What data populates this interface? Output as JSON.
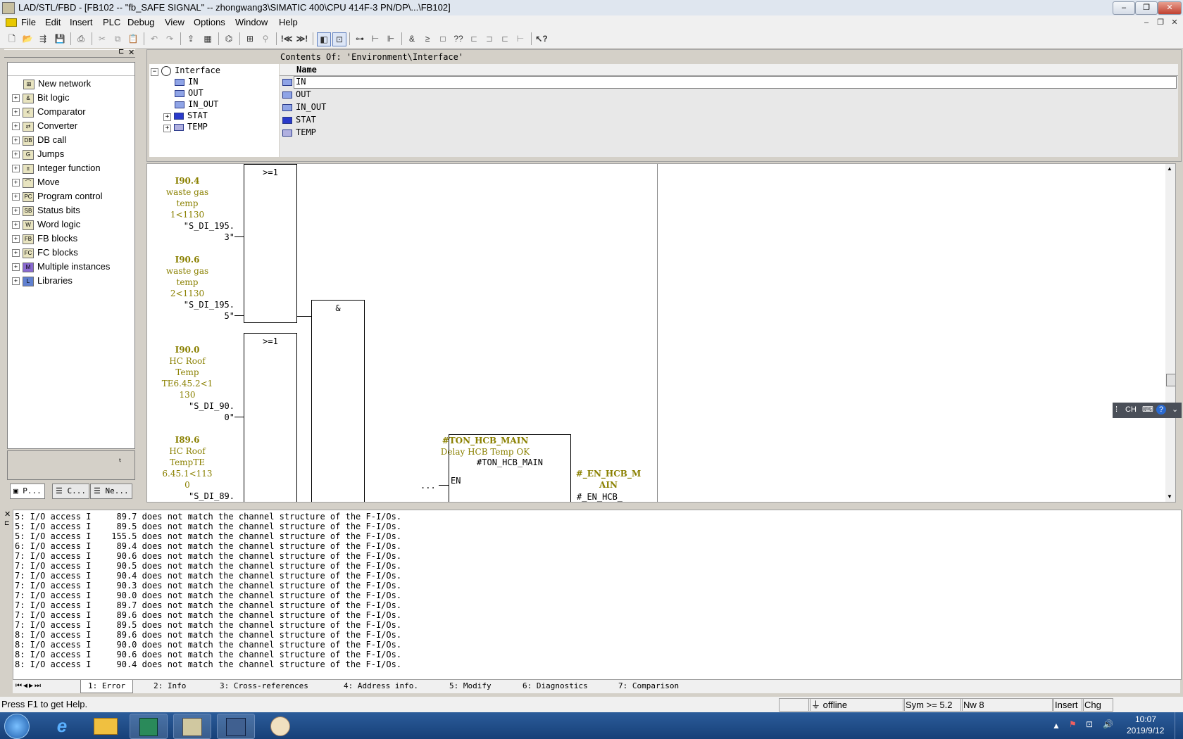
{
  "window": {
    "title": "LAD/STL/FBD  - [FB102 -- \"fb_SAFE SIGNAL\" -- zhongwang3\\SIMATIC 400\\CPU 414F-3 PN/DP\\...\\FB102]",
    "controls": [
      "–",
      "❐",
      "✕"
    ]
  },
  "menu": [
    "File",
    "Edit",
    "Insert",
    "PLC",
    "Debug",
    "View",
    "Options",
    "Window",
    "Help"
  ],
  "mdi_controls": [
    "–",
    "❐",
    "✕"
  ],
  "toolbar_icons": [
    "new-icon",
    "open-icon",
    "accessible-nodes-icon",
    "save-icon",
    "print-icon",
    "cut-icon",
    "copy-icon",
    "paste-icon",
    "undo-icon",
    "redo-icon",
    "load-icon",
    "compare-icon",
    "monitor-icon",
    "ref-icon",
    "search-icon",
    "goto-icon",
    "prev-network-icon",
    "next-network-icon",
    "overview-icon",
    "details-icon",
    "network-insert-icon",
    "branch-icon",
    "box-icon",
    "contact-icon",
    "coil-icon",
    "ladder1-icon",
    "ladder2-icon",
    "ladder3-icon",
    "ladder4-icon",
    "help-icon"
  ],
  "catalog": {
    "items": [
      {
        "label": "New network",
        "icon": "new-network-icon",
        "expandable": false
      },
      {
        "label": "Bit logic",
        "icon": "bit-logic-icon",
        "expandable": true
      },
      {
        "label": "Comparator",
        "icon": "comparator-icon",
        "expandable": true
      },
      {
        "label": "Converter",
        "icon": "converter-icon",
        "expandable": true
      },
      {
        "label": "DB call",
        "icon": "db-call-icon",
        "expandable": true
      },
      {
        "label": "Jumps",
        "icon": "jumps-icon",
        "expandable": true
      },
      {
        "label": "Integer function",
        "icon": "integer-function-icon",
        "expandable": true
      },
      {
        "label": "Move",
        "icon": "move-icon",
        "expandable": true
      },
      {
        "label": "Program control",
        "icon": "program-control-icon",
        "expandable": true
      },
      {
        "label": "Status bits",
        "icon": "status-bits-icon",
        "expandable": true
      },
      {
        "label": "Word logic",
        "icon": "word-logic-icon",
        "expandable": true
      },
      {
        "label": "FB blocks",
        "icon": "fb-blocks-icon",
        "expandable": true
      },
      {
        "label": "FC blocks",
        "icon": "fc-blocks-icon",
        "expandable": true
      },
      {
        "label": "Multiple instances",
        "icon": "multiple-instances-icon",
        "expandable": true
      },
      {
        "label": "Libraries",
        "icon": "libraries-icon",
        "expandable": true
      }
    ],
    "tabs": [
      "P...",
      "C...",
      "Ne..."
    ]
  },
  "interface_tree": {
    "root": "Interface",
    "items": [
      "IN",
      "OUT",
      "IN_OUT",
      "STAT",
      "TEMP"
    ]
  },
  "interface_contents": {
    "heading": "Contents Of: 'Environment\\Interface'",
    "column": "Name",
    "rows": [
      "IN",
      "OUT",
      "IN_OUT",
      "STAT",
      "TEMP"
    ]
  },
  "fbd": {
    "or1": ">=1",
    "or2": ">=1",
    "and": "&",
    "inputs": [
      {
        "addr": "I90.4",
        "comment": [
          "waste gas",
          "temp",
          "1<1130"
        ],
        "symbol": [
          "\"S_DI_195.",
          "3\""
        ]
      },
      {
        "addr": "I90.6",
        "comment": [
          "waste gas",
          "temp",
          "2<1130"
        ],
        "symbol": [
          "\"S_DI_195.",
          "5\""
        ]
      },
      {
        "addr": "I90.0",
        "comment": [
          "HC Roof",
          "Temp",
          "TE6.45.2<1",
          "130"
        ],
        "symbol": [
          "\"S_DI_90.",
          "0\""
        ]
      },
      {
        "addr": "I89.6",
        "comment": [
          "HC Roof",
          "TempTE",
          "6.45.1<113",
          "0"
        ],
        "symbol": [
          "\"S_DI_89."
        ]
      }
    ],
    "timer": {
      "name": "#TON_HCB_MAIN",
      "comment": "Delay HCB Temp OK",
      "instance": "#TON_HCB_MAIN",
      "en": "EN",
      "dots": "..."
    },
    "output": {
      "name": [
        "#_EN_HCB_M",
        "AIN"
      ],
      "label": "#_EN_HCB_"
    }
  },
  "ime": {
    "label": "CH"
  },
  "messages": [
    "5: I/O access I     89.7 does not match the channel structure of the F-I/Os.",
    "5: I/O access I     89.5 does not match the channel structure of the F-I/Os.",
    "5: I/O access I    155.5 does not match the channel structure of the F-I/Os.",
    "6: I/O access I     89.4 does not match the channel structure of the F-I/Os.",
    "7: I/O access I     90.6 does not match the channel structure of the F-I/Os.",
    "7: I/O access I     90.5 does not match the channel structure of the F-I/Os.",
    "7: I/O access I     90.4 does not match the channel structure of the F-I/Os.",
    "7: I/O access I     90.3 does not match the channel structure of the F-I/Os.",
    "7: I/O access I     90.0 does not match the channel structure of the F-I/Os.",
    "7: I/O access I     89.7 does not match the channel structure of the F-I/Os.",
    "7: I/O access I     89.6 does not match the channel structure of the F-I/Os.",
    "7: I/O access I     89.5 does not match the channel structure of the F-I/Os.",
    "8: I/O access I     89.6 does not match the channel structure of the F-I/Os.",
    "8: I/O access I     90.0 does not match the channel structure of the F-I/Os.",
    "8: I/O access I     90.6 does not match the channel structure of the F-I/Os.",
    "8: I/O access I     90.4 does not match the channel structure of the F-I/Os."
  ],
  "message_tabs": [
    "1: Error",
    "2: Info",
    "3: Cross-references",
    "4: Address info.",
    "5: Modify",
    "6: Diagnostics",
    "7: Comparison"
  ],
  "status": {
    "help": "Press F1 to get Help.",
    "mode": "offline",
    "sym": "Sym >= 5.2",
    "nw": "Nw 8",
    "insert": "Insert",
    "chg": "Chg"
  },
  "taskbar": {
    "apps": [
      "start-orb-icon",
      "ie-icon",
      "explorer-icon",
      "simatic-manager-icon",
      "lad-stl-fbd-icon",
      "hw-config-icon",
      "paint-icon"
    ],
    "time": "10:07",
    "date": "2019/9/12"
  },
  "colors": {
    "fbd_label": "#8a8000",
    "taskbar": "#174078",
    "selected_row": "#ffffff"
  }
}
